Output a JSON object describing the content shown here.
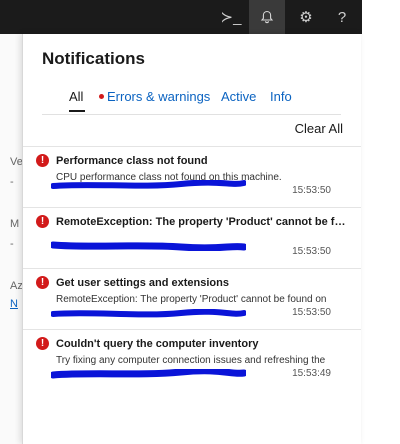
{
  "topbar": {
    "icons": [
      "terminal-icon",
      "bell-icon",
      "gear-icon",
      "help-icon"
    ],
    "glyphs": {
      "terminal": "≻_",
      "bell": "🔔",
      "gear": "⚙",
      "help": "?"
    }
  },
  "background": {
    "fragments": [
      "Ve",
      "-",
      "M",
      "-",
      "Az"
    ],
    "link": "N"
  },
  "panel": {
    "title": "Notifications",
    "tabs": [
      {
        "label": "All"
      },
      {
        "label": "Errors & warnings"
      },
      {
        "label": "Active"
      },
      {
        "label": "Info"
      }
    ],
    "clear_all": "Clear All"
  },
  "notifications": [
    {
      "title": "Performance class not found",
      "message": "CPU performance class not found on this machine.",
      "time": "15:53:50"
    },
    {
      "title": "RemoteException: The property 'Product' cannot be fo...",
      "message": "",
      "time": "15:53:50"
    },
    {
      "title": "Get user settings and extensions",
      "message": "RemoteException: The property 'Product' cannot be found on",
      "time": "15:53:50"
    },
    {
      "title": "Couldn't query the computer inventory",
      "message": "Try fixing any computer connection issues and refreshing the",
      "time": "15:53:49"
    }
  ],
  "colors": {
    "topbar_bg": "#1b1b1b",
    "link": "#0b63c1",
    "error": "#d21a1a",
    "redaction": "#0a14d8"
  }
}
